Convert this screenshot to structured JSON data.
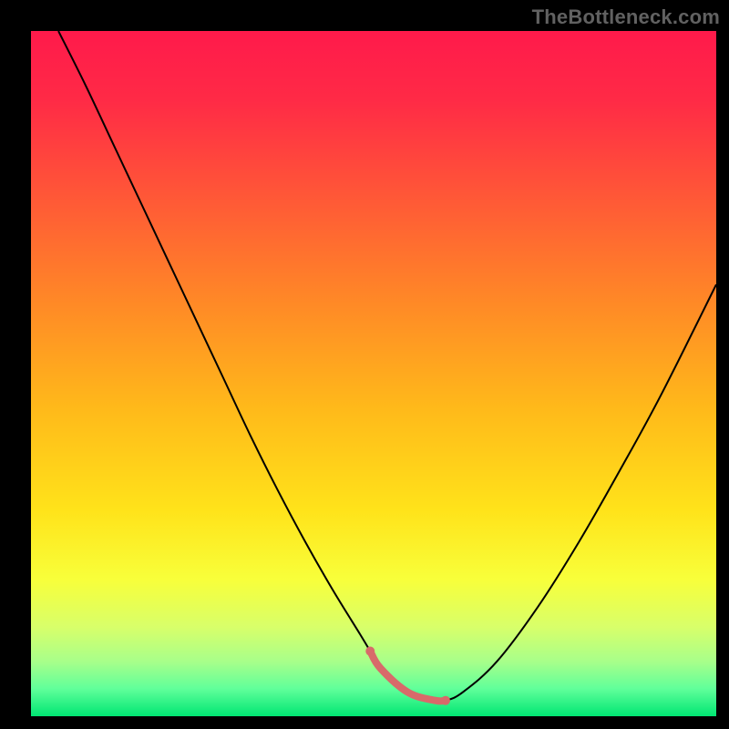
{
  "watermark": "TheBottleneck.com",
  "chart_data": {
    "type": "line",
    "title": "",
    "xlabel": "",
    "ylabel": "",
    "xlim": [
      0,
      100
    ],
    "ylim": [
      0,
      100
    ],
    "grid": false,
    "legend": false,
    "annotations": [],
    "background_gradient": [
      {
        "stop": 0.0,
        "color": "#ff1a4b"
      },
      {
        "stop": 0.1,
        "color": "#ff2a46"
      },
      {
        "stop": 0.25,
        "color": "#ff5a36"
      },
      {
        "stop": 0.4,
        "color": "#ff8a26"
      },
      {
        "stop": 0.55,
        "color": "#ffb91a"
      },
      {
        "stop": 0.7,
        "color": "#ffe31a"
      },
      {
        "stop": 0.8,
        "color": "#f8ff3a"
      },
      {
        "stop": 0.87,
        "color": "#d8ff6a"
      },
      {
        "stop": 0.92,
        "color": "#a8ff8a"
      },
      {
        "stop": 0.96,
        "color": "#60ff9a"
      },
      {
        "stop": 1.0,
        "color": "#00e673"
      }
    ],
    "series": [
      {
        "name": "bottleneck-curve",
        "type": "line",
        "stroke": "#000000",
        "stroke_width": 2,
        "x": [
          4,
          8,
          12,
          16,
          20,
          24,
          28,
          32,
          36,
          40,
          44,
          48,
          49.5,
          51,
          55,
          59,
          60.5,
          63,
          68,
          74,
          80,
          86,
          92,
          100
        ],
        "y": [
          100,
          92,
          83.5,
          75,
          66.5,
          58,
          49.5,
          41,
          33,
          25.5,
          18.5,
          12,
          9.5,
          7,
          3.5,
          2.3,
          2.3,
          3.5,
          8,
          16,
          25.5,
          36,
          47,
          63
        ]
      },
      {
        "name": "optimal-zone",
        "type": "line",
        "stroke": "#d86a6a",
        "stroke_width": 8,
        "stroke_linecap": "round",
        "x": [
          49.5,
          51,
          55,
          59,
          60.5
        ],
        "y": [
          9.5,
          7,
          3.5,
          2.3,
          2.3
        ]
      }
    ],
    "optimal_range_pct": [
      49.5,
      60.5
    ]
  }
}
